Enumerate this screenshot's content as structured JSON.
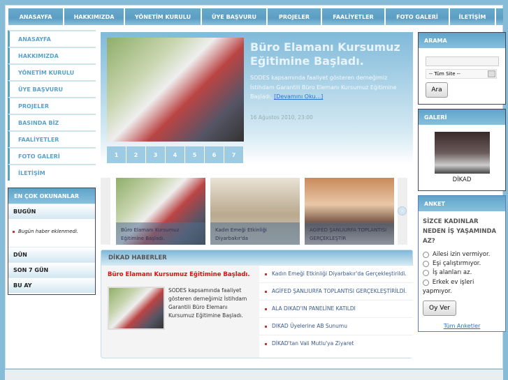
{
  "top_nav": [
    "ANASAYFA",
    "HAKKIMIZDA",
    "YÖNETİM KURULU",
    "ÜYE BAŞVURU",
    "PROJELER",
    "FAALİYETLER",
    "FOTO GALERİ",
    "İLETİŞİM"
  ],
  "left_nav": [
    "ANASAYFA",
    "HAKKIMIZDA",
    "YÖNETİM KURULU",
    "ÜYE BAŞVURU",
    "PROJELER",
    "BASINDA BİZ",
    "FAALİYETLER",
    "FOTO GALERİ",
    "İLETİŞİM"
  ],
  "most_read": {
    "title": "EN ÇOK OKUNANLAR",
    "today": "BUGÜN",
    "today_empty": "Bugün haber eklenmedi.",
    "yesterday": "DÜN",
    "last7": "SON 7 GÜN",
    "this_month": "BU AY"
  },
  "featured": {
    "title": "Büro Elamanı Kursumuz Eğitimine Başladı.",
    "summary": "SODES kapsamında faaliyet gösteren derneğimiz İstihdam Garantili Büro Elemanı Kursumuz Eğitimine Başladı.",
    "read_more": "[Devamını Oku...]",
    "date": "16 Ağustos 2010, 23:00",
    "pages": [
      "1",
      "2",
      "3",
      "4",
      "5",
      "6",
      "7"
    ]
  },
  "thumbs": [
    "Büro Elamanı Kursumuz Eğitimine Başladı.",
    "Kadın Emeği Etkinliği Diyarbakır'da",
    "AGİFED ŞANLIURFA TOPLANTISI GERÇEKLEŞTİR"
  ],
  "news": {
    "title": "DİKAD HABERLER",
    "lead_title": "Büro Elamanı Kursumuz Eğitimine Başladı.",
    "lead_text": "SODES kapsamında faaliyet gösteren derneğimiz İstihdam Garantili Büro Elemanı Kursumuz Eğitimine Başladı.",
    "items": [
      "Kadın Emeği Etkinliği Diyarbakır'da Gerçekleştirildi.",
      "AGİFED ŞANLIURFA TOPLANTISI GERÇEKLEŞTİRİLDİ.",
      "ALA DIKAD'IN PANELİNE KATILDI",
      "DIKAD Üyelerine AB Sunumu",
      "DİKAD'tan Vali Mutlu'ya Ziyaret"
    ]
  },
  "search": {
    "title": "ARAMA",
    "value": "",
    "scope": "-- Tüm Site --",
    "button": "Ara"
  },
  "gallery": {
    "title": "GALERİ",
    "caption": "DİKAD"
  },
  "poll": {
    "title": "ANKET",
    "question": "SİZCE KADINLAR NEDEN İŞ YAŞAMINDA AZ?",
    "options": [
      "Ailesi izin vermiyor.",
      "Eşi çalıştırmıyor.",
      "İş alanları az.",
      "Erkek ev işleri yapmıyor."
    ],
    "vote": "Oy Ver",
    "all": "Tüm Anketler"
  }
}
